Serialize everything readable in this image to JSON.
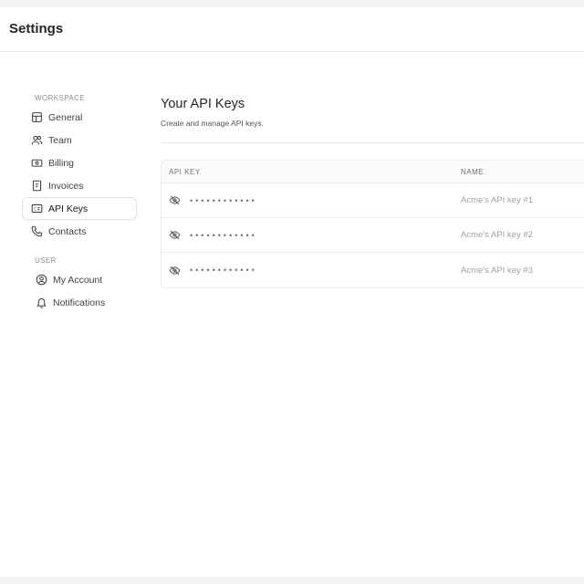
{
  "app": {
    "title": "Settings"
  },
  "sidebar": {
    "workspace_label": "WORKSPACE",
    "workspace_items": [
      {
        "label": "General",
        "icon": "layout-icon"
      },
      {
        "label": "Team",
        "icon": "users-icon"
      },
      {
        "label": "Billing",
        "icon": "banknote-icon"
      },
      {
        "label": "Invoices",
        "icon": "receipt-icon"
      },
      {
        "label": "API Keys",
        "icon": "api-key-icon",
        "active": true
      },
      {
        "label": "Contacts",
        "icon": "phone-icon"
      }
    ],
    "user_label": "USER",
    "user_items": [
      {
        "label": "My Account",
        "icon": "user-circle-icon"
      },
      {
        "label": "Notifications",
        "icon": "bell-icon"
      }
    ]
  },
  "main": {
    "title": "Your API Keys",
    "subtitle": "Create and manage API keys.",
    "table": {
      "columns": [
        "API KEY",
        "NAME"
      ],
      "rows": [
        {
          "key": "••••••••••••",
          "name": "Acme's API key #1",
          "icon": "eye-off-icon"
        },
        {
          "key": "••••••••••••",
          "name": "Acme's API key #2",
          "icon": "eye-off-icon"
        },
        {
          "key": "••••••••••••",
          "name": "Acme's API key #3",
          "icon": "eye-off-icon"
        }
      ]
    }
  },
  "colors": {
    "page_background": "#f3f3f4",
    "panel_background": "#ffffff",
    "border": "#e8e8ea",
    "muted_text": "#a1a1aa"
  }
}
